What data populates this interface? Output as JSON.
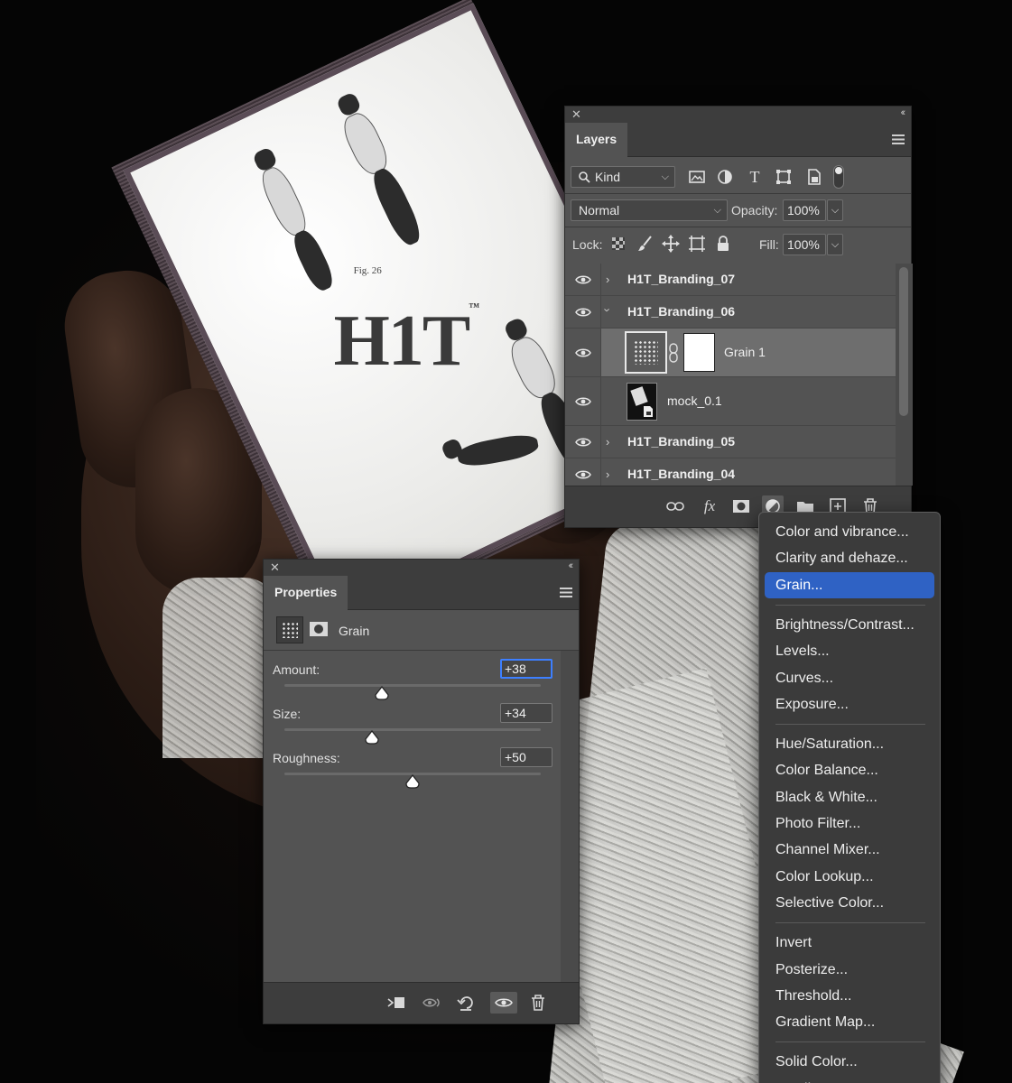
{
  "layers_panel": {
    "tab": "Layers",
    "filter_kind": "Kind",
    "blend_mode": "Normal",
    "opacity_label": "Opacity:",
    "opacity_value": "100%",
    "lock_label": "Lock:",
    "fill_label": "Fill:",
    "fill_value": "100%",
    "layers": [
      {
        "name": "H1T_Branding_07",
        "type": "group",
        "expanded": false
      },
      {
        "name": "H1T_Branding_06",
        "type": "group",
        "expanded": true
      },
      {
        "name": "Grain 1",
        "type": "adjustment",
        "selected": true
      },
      {
        "name": "mock_0.1",
        "type": "smart-object"
      },
      {
        "name": "H1T_Branding_05",
        "type": "group",
        "expanded": false
      },
      {
        "name": "H1T_Branding_04",
        "type": "group",
        "expanded": false
      }
    ],
    "footer_fx": "fx"
  },
  "properties_panel": {
    "tab": "Properties",
    "adjustment_name": "Grain",
    "sliders": [
      {
        "label": "Amount:",
        "value": "+38",
        "fraction": 0.38,
        "focused": true
      },
      {
        "label": "Size:",
        "value": "+34",
        "fraction": 0.34,
        "focused": false
      },
      {
        "label": "Roughness:",
        "value": "+50",
        "fraction": 0.5,
        "focused": false
      }
    ]
  },
  "adjustment_menu": {
    "groups": [
      [
        "Color and vibrance...",
        "Clarity and dehaze...",
        "Grain..."
      ],
      [
        "Brightness/Contrast...",
        "Levels...",
        "Curves...",
        "Exposure..."
      ],
      [
        "Hue/Saturation...",
        "Color Balance...",
        "Black & White...",
        "Photo Filter...",
        "Channel Mixer...",
        "Color Lookup...",
        "Selective Color..."
      ],
      [
        "Invert",
        "Posterize...",
        "Threshold...",
        "Gradient Map..."
      ],
      [
        "Solid Color...",
        "Gradient..."
      ]
    ],
    "highlighted": "Grain..."
  },
  "canvas": {
    "card_brand": "H1T",
    "card_brand_mark": "™",
    "card_fig_label": "Fig. 26"
  },
  "colors": {
    "panel_bg": "#535353",
    "panel_header": "#3d3d3d",
    "selection_row": "#6e6e6e",
    "menu_highlight": "#2f62c4",
    "focus_ring": "#3d7fff"
  }
}
